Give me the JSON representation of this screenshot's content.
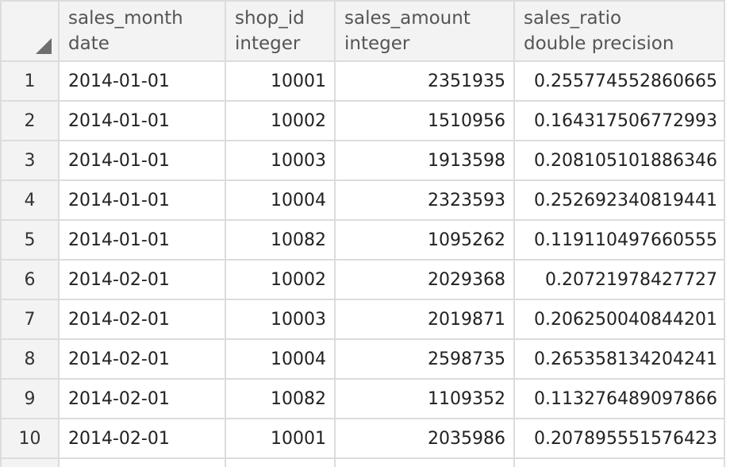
{
  "columns": [
    {
      "name": "sales_month",
      "type": "date"
    },
    {
      "name": "shop_id",
      "type": "integer"
    },
    {
      "name": "sales_amount",
      "type": "integer"
    },
    {
      "name": "sales_ratio",
      "type": "double precision"
    }
  ],
  "rows": [
    {
      "n": "1",
      "sales_month": "2014-01-01",
      "shop_id": "10001",
      "sales_amount": "2351935",
      "sales_ratio": "0.255774552860665"
    },
    {
      "n": "2",
      "sales_month": "2014-01-01",
      "shop_id": "10002",
      "sales_amount": "1510956",
      "sales_ratio": "0.164317506772993"
    },
    {
      "n": "3",
      "sales_month": "2014-01-01",
      "shop_id": "10003",
      "sales_amount": "1913598",
      "sales_ratio": "0.208105101886346"
    },
    {
      "n": "4",
      "sales_month": "2014-01-01",
      "shop_id": "10004",
      "sales_amount": "2323593",
      "sales_ratio": "0.252692340819441"
    },
    {
      "n": "5",
      "sales_month": "2014-01-01",
      "shop_id": "10082",
      "sales_amount": "1095262",
      "sales_ratio": "0.119110497660555"
    },
    {
      "n": "6",
      "sales_month": "2014-02-01",
      "shop_id": "10002",
      "sales_amount": "2029368",
      "sales_ratio": "0.20721978427727"
    },
    {
      "n": "7",
      "sales_month": "2014-02-01",
      "shop_id": "10003",
      "sales_amount": "2019871",
      "sales_ratio": "0.206250040844201"
    },
    {
      "n": "8",
      "sales_month": "2014-02-01",
      "shop_id": "10004",
      "sales_amount": "2598735",
      "sales_ratio": "0.265358134204241"
    },
    {
      "n": "9",
      "sales_month": "2014-02-01",
      "shop_id": "10082",
      "sales_amount": "1109352",
      "sales_ratio": "0.113276489097866"
    },
    {
      "n": "10",
      "sales_month": "2014-02-01",
      "shop_id": "10001",
      "sales_amount": "2035986",
      "sales_ratio": "0.207895551576423"
    }
  ]
}
